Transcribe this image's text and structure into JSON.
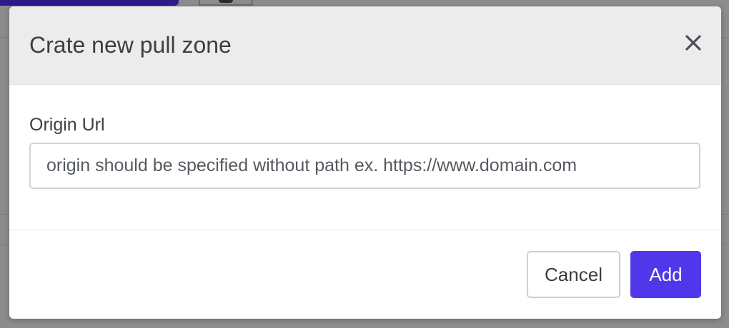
{
  "colors": {
    "primary": "#5137ea",
    "header_bg": "#ececec",
    "overlay": "#8c8c8c",
    "text": "#3b3f44"
  },
  "modal": {
    "title": "Crate new pull zone",
    "close_icon": "close-icon",
    "origin_field": {
      "label": "Origin Url",
      "value": "",
      "placeholder": "origin should be specified without path ex. https://www.domain.com"
    },
    "footer": {
      "cancel_label": "Cancel",
      "add_label": "Add"
    }
  }
}
